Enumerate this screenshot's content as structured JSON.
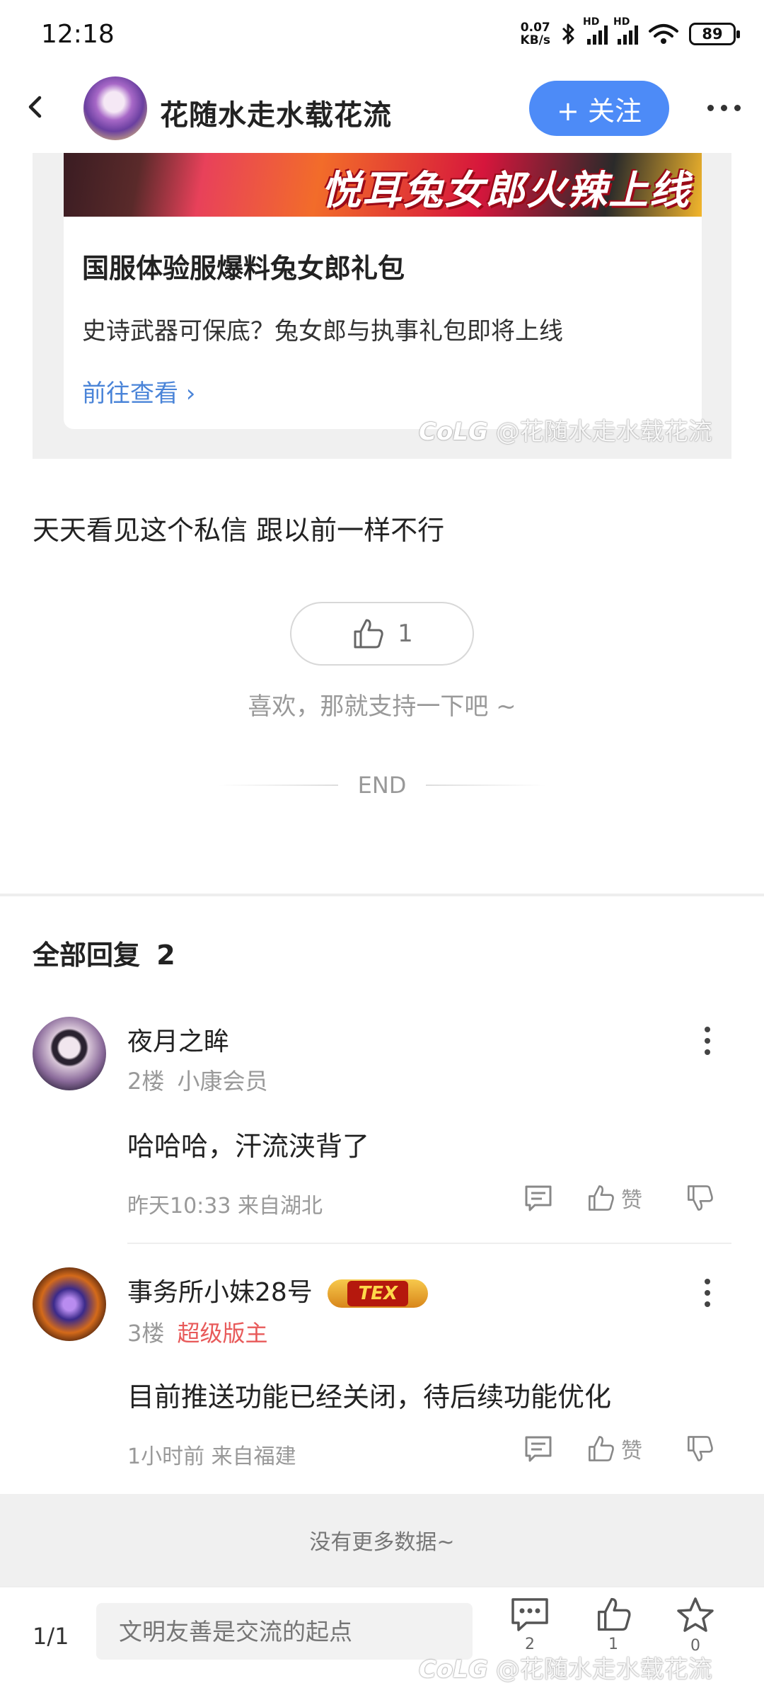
{
  "status_bar": {
    "time": "12:18",
    "net_speed_value": "0.07",
    "net_speed_unit": "KB/s",
    "signal_badge": "HD",
    "battery": "89"
  },
  "header": {
    "author_name": "花随水走水载花流",
    "follow_label": "+ 关注"
  },
  "card": {
    "banner_text": "悦耳兔女郎火辣上线",
    "title": "国服体验服爆料兔女郎礼包",
    "description": "史诗武器可保底？兔女郎与执事礼包即将上线",
    "link_label": "前往查看 ›"
  },
  "watermark": {
    "logo": "CoLG",
    "text": "@花随水走水载花流"
  },
  "post": {
    "text": "天天看见这个私信  跟以前一样不行",
    "like_count": "1",
    "like_hint": "喜欢，那就支持一下吧 ~",
    "end_label": "END"
  },
  "replies": {
    "header_label": "全部回复",
    "header_count": "2",
    "items": [
      {
        "name": "夜月之眸",
        "floor": "2楼",
        "role": "小康会员",
        "text": "哈哈哈，汗流浃背了",
        "time_location": "昨天10:33 来自湖北",
        "like_label": "赞"
      },
      {
        "name": "事务所小妹28号",
        "badge": "TEX",
        "floor": "3楼",
        "role": "超级版主",
        "text": "目前推送功能已经关闭，待后续功能优化",
        "time_location": "1小时前 来自福建",
        "like_label": "赞"
      }
    ],
    "no_more": "没有更多数据~"
  },
  "bottom_bar": {
    "page_indicator": "1/1",
    "input_placeholder": "文明友善是交流的起点",
    "comment_count": "2",
    "like_count": "1",
    "favorite_count": "0"
  },
  "colors": {
    "accent": "#4d8bf7",
    "link": "#4a84d8",
    "role_red": "#e85a5a"
  }
}
